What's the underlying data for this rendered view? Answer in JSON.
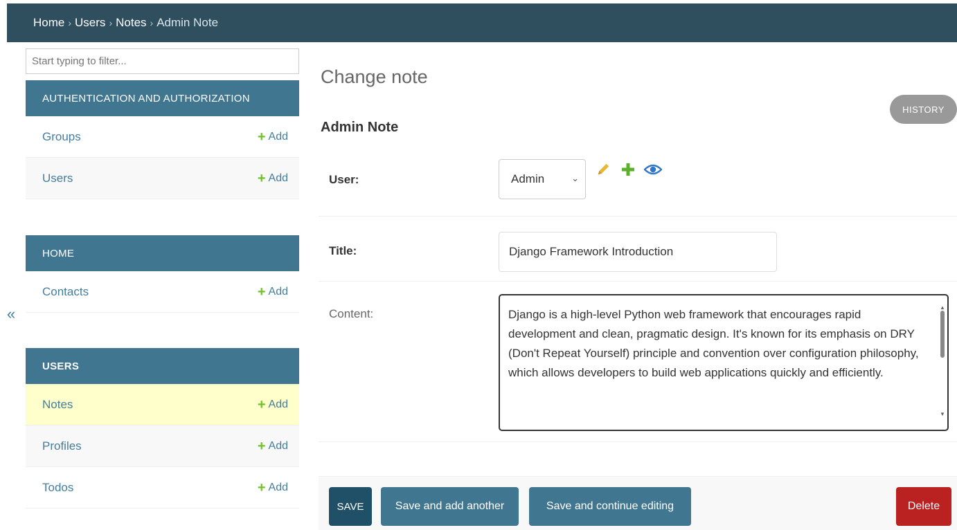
{
  "breadcrumb": {
    "items": [
      "Home",
      "Users",
      "Notes"
    ],
    "current": "Admin Note",
    "separator": "›"
  },
  "sidebar": {
    "filter_placeholder": "Start typing to filter...",
    "collapse_label": "«",
    "modules": [
      {
        "title": "AUTHENTICATION AND AUTHORIZATION",
        "models": [
          {
            "name": "Groups",
            "add": "Add"
          },
          {
            "name": "Users",
            "add": "Add"
          }
        ]
      },
      {
        "title": "HOME",
        "models": [
          {
            "name": "Contacts",
            "add": "Add"
          }
        ]
      },
      {
        "title": "USERS",
        "models": [
          {
            "name": "Notes",
            "add": "Add",
            "selected": true
          },
          {
            "name": "Profiles",
            "add": "Add"
          },
          {
            "name": "Todos",
            "add": "Add"
          }
        ]
      }
    ]
  },
  "main": {
    "page_title": "Change note",
    "object_title": "Admin Note",
    "history_label": "HISTORY",
    "fields": {
      "user": {
        "label": "User:",
        "value": "Admin"
      },
      "title": {
        "label": "Title:",
        "value": "Django Framework Introduction"
      },
      "content": {
        "label": "Content:",
        "value": "Django is a high-level Python web framework that encourages rapid development and clean, pragmatic design. It's known for its emphasis on DRY (Don't Repeat Yourself) principle and convention over configuration philosophy, which allows developers to build web applications quickly and efficiently."
      }
    },
    "related_icons": [
      "pencil-icon",
      "plus-icon",
      "eye-icon"
    ]
  },
  "submit": {
    "save": "SAVE",
    "save_add_another": "Save and add another",
    "save_continue": "Save and continue editing",
    "delete": "Delete"
  },
  "colors": {
    "header_bg": "#2f4e5e",
    "module_bg": "#417690",
    "link": "#447e9b",
    "add_plus": "#70bf2b",
    "selected_row": "#ffffcc",
    "delete": "#ba2121"
  }
}
